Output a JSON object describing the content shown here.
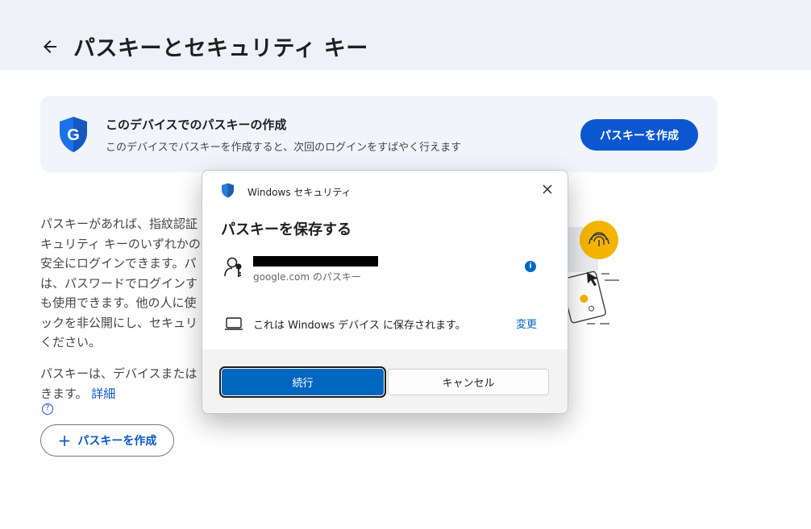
{
  "header": {
    "title": "パスキーとセキュリティ キー"
  },
  "promo": {
    "title": "このデバイスでのパスキーの作成",
    "description": "このデバイスでパスキーを作成すると、次回のログインをすばやく行えます",
    "button_label": "パスキーを作成"
  },
  "body": {
    "paragraph1_lines": [
      "パスキーがあれば、指紋認証",
      "キュリティ キーのいずれかの",
      "安全にログインできます。パ",
      "は、パスワードでログインす",
      "も使用できます。他の人に使",
      "ックを非公開にし、セキュリ",
      "ください。"
    ],
    "paragraph2_line1": "パスキーは、デバイスまたは",
    "paragraph2_line2": "きます。",
    "detail_link": "詳細",
    "create_button_label": "パスキーを作成"
  },
  "dialog": {
    "window_title": "Windows セキュリティ",
    "heading": "パスキーを保存する",
    "site_label": "google.com のパスキー",
    "info_icon_text": "i",
    "save_location_text": "これは Windows デバイス に保存されます。",
    "change_link": "変更",
    "continue_label": "続行",
    "cancel_label": "キャンセル"
  },
  "colors": {
    "accent": "#0b57d0",
    "windows_accent": "#0067c0",
    "header_bg": "#eef1f6",
    "illustration_yellow": "#f4b400"
  }
}
